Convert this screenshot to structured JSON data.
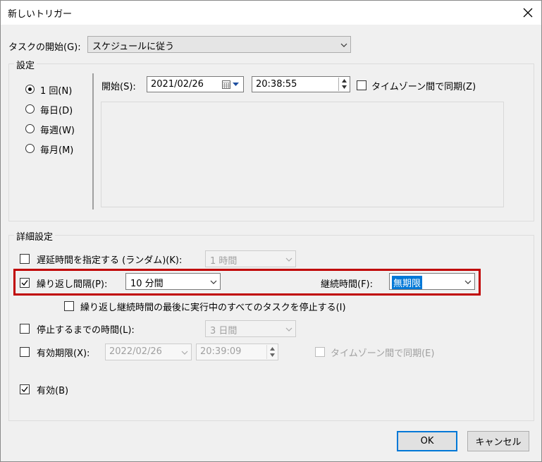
{
  "window": {
    "title": "新しいトリガー"
  },
  "task_start": {
    "label": "タスクの開始(G):",
    "value": "スケジュールに従う"
  },
  "settings": {
    "title": "設定",
    "radios": [
      {
        "label": "1 回(N)",
        "selected": true
      },
      {
        "label": "毎日(D)",
        "selected": false
      },
      {
        "label": "毎週(W)",
        "selected": false
      },
      {
        "label": "毎月(M)",
        "selected": false
      }
    ],
    "start_label": "開始(S):",
    "start_date": "2021/02/26",
    "start_time": "20:38:55",
    "sync_tz_label": "タイムゾーン間で同期(Z)"
  },
  "advanced": {
    "title": "詳細設定",
    "delay": {
      "label": "遅延時間を指定する (ランダム)(K):",
      "value": "1 時間",
      "checked": false
    },
    "repeat": {
      "label": "繰り返し間隔(P):",
      "value": "10 分間",
      "checked": true,
      "duration_label": "継続時間(F):",
      "duration_value": "無期限"
    },
    "stop_all": {
      "label": "繰り返し継続時間の最後に実行中のすべてのタスクを停止する(I)",
      "checked": false
    },
    "stop_after": {
      "label": "停止するまでの時間(L):",
      "value": "3 日間",
      "checked": false
    },
    "expire": {
      "label": "有効期限(X):",
      "date": "2022/02/26",
      "time": "20:39:09",
      "sync_label": "タイムゾーン間で同期(E)",
      "checked": false
    },
    "enabled": {
      "label": "有効(B)",
      "checked": true
    }
  },
  "buttons": {
    "ok": "OK",
    "cancel": "キャンセル"
  },
  "colors": {
    "accent": "#0078d7",
    "highlight_border": "#c00000"
  }
}
